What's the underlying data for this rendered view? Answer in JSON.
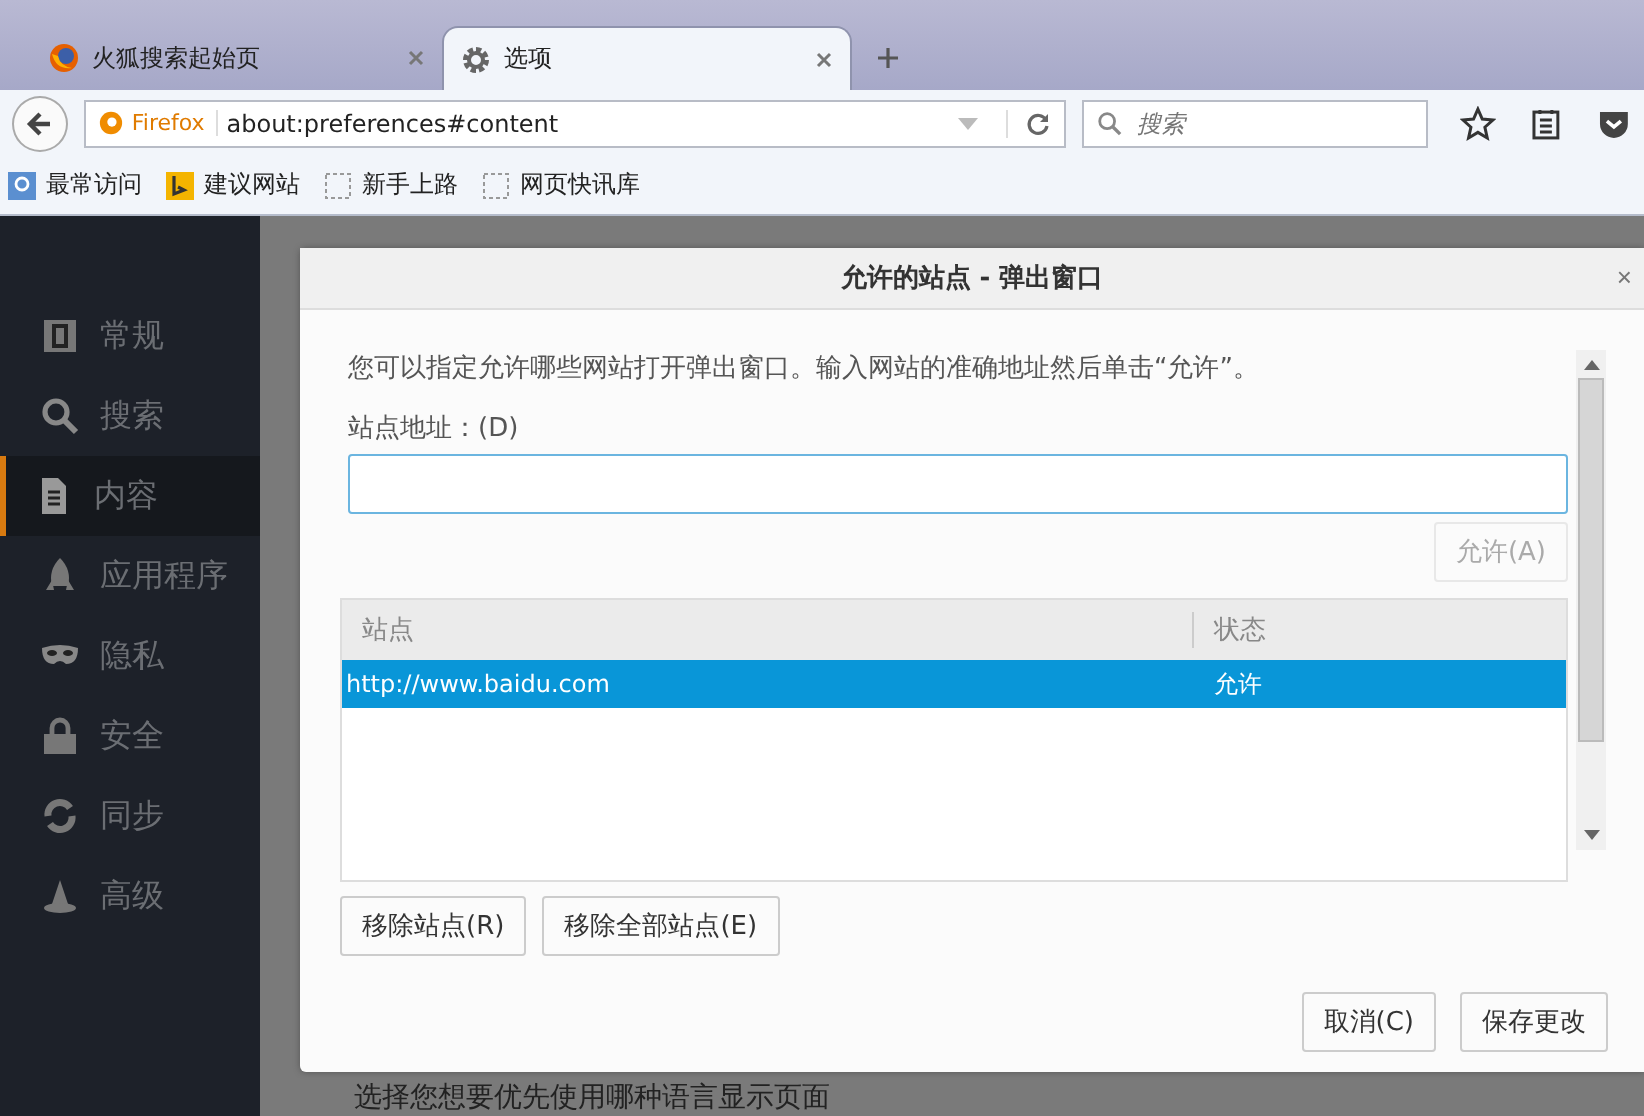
{
  "tabs": [
    {
      "label": "火狐搜索起始页",
      "selected": false
    },
    {
      "label": "选项",
      "selected": true
    }
  ],
  "nav": {
    "identity": "Firefox",
    "url": "about:preferences#content",
    "search_placeholder": "搜索"
  },
  "bookmarks": [
    {
      "label": "最常访问"
    },
    {
      "label": "建议网站"
    },
    {
      "label": "新手上路"
    },
    {
      "label": "网页快讯库"
    }
  ],
  "sidebar": {
    "items": [
      {
        "label": "常规",
        "selected": false
      },
      {
        "label": "搜索",
        "selected": false
      },
      {
        "label": "内容",
        "selected": true
      },
      {
        "label": "应用程序",
        "selected": false
      },
      {
        "label": "隐私",
        "selected": false
      },
      {
        "label": "安全",
        "selected": false
      },
      {
        "label": "同步",
        "selected": false
      },
      {
        "label": "高级",
        "selected": false
      }
    ]
  },
  "background_text": "选择您想要优先使用哪种语言显示页面",
  "dialog": {
    "title": "允许的站点 - 弹出窗口",
    "close": "×",
    "intro": "您可以指定允许哪些网站打开弹出窗口。输入网站的准确地址然后单击“允许”。",
    "address_label": "站点地址：(D)",
    "allow_button": {
      "label": "允许(A)",
      "disabled": true
    },
    "table": {
      "columns": [
        "站点",
        "状态"
      ],
      "rows": [
        {
          "site": "http://www.baidu.com",
          "status": "允许",
          "selected": true
        }
      ]
    },
    "remove_buttons": [
      "移除站点(R)",
      "移除全部站点(E)"
    ],
    "footer_buttons": [
      "取消(C)",
      "保存更改"
    ]
  }
}
